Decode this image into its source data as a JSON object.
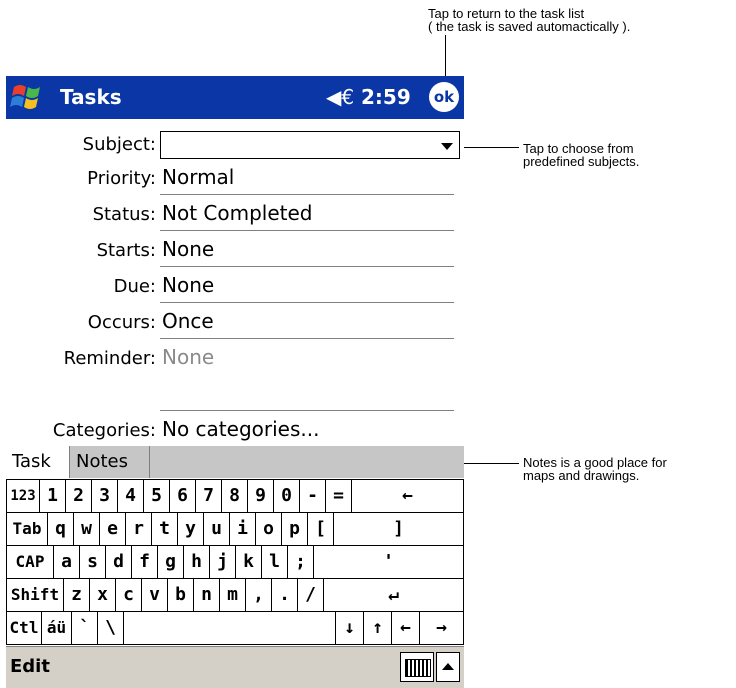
{
  "callouts": {
    "ok_note_line1": "Tap to return to the task list",
    "ok_note_line2": "( the task is saved automactically ).",
    "subject_note_line1": "Tap to choose from",
    "subject_note_line2": "predefined subjects.",
    "notes_note_line1": "Notes is a good place for",
    "notes_note_line2": "maps and drawings."
  },
  "titlebar": {
    "title": "Tasks",
    "speaker_icon": "◀€",
    "time": "2:59",
    "ok": "ok"
  },
  "form": {
    "subject_label": "Subject:",
    "subject_value": "",
    "priority_label": "Priority:",
    "priority_value": "Normal",
    "status_label": "Status:",
    "status_value": "Not Completed",
    "starts_label": "Starts:",
    "starts_value": "None",
    "due_label": "Due:",
    "due_value": "None",
    "occurs_label": "Occurs:",
    "occurs_value": "Once",
    "reminder_label": "Reminder:",
    "reminder_value": "None",
    "categories_label": "Categories:",
    "categories_value": "No categories..."
  },
  "tabs": {
    "task": "Task",
    "notes": "Notes"
  },
  "keyboard": {
    "row1": [
      "123",
      "1",
      "2",
      "3",
      "4",
      "5",
      "6",
      "7",
      "8",
      "9",
      "0",
      "-",
      "=",
      "←"
    ],
    "row2": [
      "Tab",
      "q",
      "w",
      "e",
      "r",
      "t",
      "y",
      "u",
      "i",
      "o",
      "p",
      "[",
      "]"
    ],
    "row3": [
      "CAP",
      "a",
      "s",
      "d",
      "f",
      "g",
      "h",
      "j",
      "k",
      "l",
      ";",
      "'"
    ],
    "row4": [
      "Shift",
      "z",
      "x",
      "c",
      "v",
      "b",
      "n",
      "m",
      ",",
      ".",
      "/",
      "↵"
    ],
    "row5": [
      "Ctl",
      "áü",
      "`",
      "\\",
      "",
      "↓",
      "↑",
      "←",
      "→"
    ]
  },
  "menubar": {
    "edit": "Edit"
  }
}
